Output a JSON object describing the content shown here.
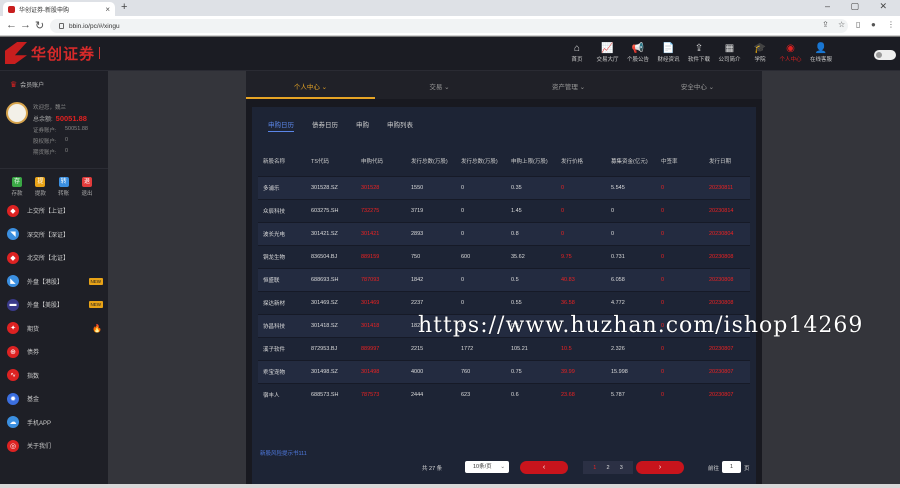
{
  "browser": {
    "tab_title": "华创证券-新股申购",
    "url": "bbin.io/pc/#/xingu",
    "close": "×",
    "new_tab": "+",
    "window_controls": "–  ▢  ✕"
  },
  "app": {
    "logo_text": "华创证券",
    "nav": [
      {
        "label": "首页",
        "icon": "home-icon",
        "glyph": "⌂"
      },
      {
        "label": "交易大厅",
        "icon": "chart-icon",
        "glyph": "📈"
      },
      {
        "label": "个股公告",
        "icon": "speaker-icon",
        "glyph": "📢"
      },
      {
        "label": "财经资讯",
        "icon": "news-icon",
        "glyph": "📄"
      },
      {
        "label": "软件下载",
        "icon": "download-icon",
        "glyph": "⇪"
      },
      {
        "label": "公司简介",
        "icon": "company-icon",
        "glyph": "▦"
      },
      {
        "label": "学院",
        "icon": "academy-icon",
        "glyph": "🎓"
      },
      {
        "label": "个人中心",
        "icon": "user-icon",
        "glyph": "◉",
        "active": true
      },
      {
        "label": "在线客服",
        "icon": "support-icon",
        "glyph": "👤"
      }
    ],
    "colors": {
      "brand": "#c81e1e",
      "accent": "#e6a425",
      "link": "#4f7ae0"
    }
  },
  "sidebar": {
    "header": "会员账户",
    "greeting": "欢迎您，魏兰",
    "total_label": "总余额:",
    "total_value": "50051.88",
    "rows": [
      {
        "label": "证券账户:",
        "value": "50051.88"
      },
      {
        "label": "股权账户:",
        "value": "0"
      },
      {
        "label": "期货账户:",
        "value": "0"
      }
    ],
    "quick": [
      {
        "label": "存款",
        "glyph": "存",
        "color": "#3aa845"
      },
      {
        "label": "提款",
        "glyph": "提",
        "color": "#e8a317"
      },
      {
        "label": "转账",
        "glyph": "转",
        "color": "#3b8fe0"
      },
      {
        "label": "退出",
        "glyph": "退",
        "color": "#e23b3b"
      }
    ],
    "menu": [
      {
        "label": "上交所【上证】",
        "glyph": "◆",
        "color": "#d22"
      },
      {
        "label": "深交所【深证】",
        "glyph": "◥",
        "color": "#3b8fe0"
      },
      {
        "label": "北交所【北证】",
        "glyph": "◆",
        "color": "#d22"
      },
      {
        "label": "外盘【港股】",
        "glyph": "◣",
        "color": "#3b8fe0",
        "badge": "NEW"
      },
      {
        "label": "外盘【美股】",
        "glyph": "▬",
        "color": "#3a3a8a",
        "badge": "NEW"
      },
      {
        "label": "期货",
        "glyph": "✦",
        "color": "#d22",
        "fire": "🔥"
      },
      {
        "label": "债券",
        "glyph": "⊕",
        "color": "#d22"
      },
      {
        "label": "指数",
        "glyph": "∿",
        "color": "#d22"
      },
      {
        "label": "基金",
        "glyph": "✹",
        "color": "#3b6fe0"
      },
      {
        "label": "手机APP",
        "glyph": "☁",
        "color": "#3b8fe0"
      },
      {
        "label": "关于我们",
        "glyph": "◎",
        "color": "#d22"
      }
    ]
  },
  "subnav": [
    {
      "label": "个人中心",
      "active": true
    },
    {
      "label": "交易",
      "active": false
    },
    {
      "label": "资产管理",
      "active": false
    },
    {
      "label": "安全中心",
      "active": false
    }
  ],
  "panel_tabs": [
    {
      "label": "申购日历",
      "active": true
    },
    {
      "label": "债券日历",
      "active": false
    },
    {
      "label": "申购",
      "active": false
    },
    {
      "label": "申购列表",
      "active": false
    }
  ],
  "table": {
    "columns": [
      "新股名称",
      "TS代码",
      "申购代码",
      "发行总数(万股)",
      "发行总数(万股)",
      "申购上限(万股)",
      "发行价格",
      "募集资金(亿元)",
      "中签率",
      "发行日期"
    ],
    "rows": [
      [
        "多浦乐",
        "301528.SZ",
        "301528",
        "1550",
        "0",
        "0.35",
        "0",
        "5.545",
        "0",
        "20230811"
      ],
      [
        "众辰科技",
        "603275.SH",
        "732275",
        "3719",
        "0",
        "1.45",
        "0",
        "0",
        "0",
        "20230814"
      ],
      [
        "波长光电",
        "301421.SZ",
        "301421",
        "2893",
        "0",
        "0.8",
        "0",
        "0",
        "0",
        "20230804"
      ],
      [
        "铜龙生物",
        "836504.BJ",
        "889159",
        "750",
        "600",
        "35.62",
        "9.75",
        "0.731",
        "0",
        "20230808"
      ],
      [
        "恒盛联",
        "688693.SH",
        "787093",
        "1842",
        "0",
        "0.5",
        "40.83",
        "6.058",
        "0",
        "20230808"
      ],
      [
        "探达新材",
        "301469.SZ",
        "301469",
        "2237",
        "0",
        "0.55",
        "36.58",
        "4.772",
        "0",
        "20230808"
      ],
      [
        "协昌科技",
        "301418.SZ",
        "301418",
        "1823",
        "0",
        "0.5",
        "",
        "",
        "0",
        ""
      ],
      [
        "溪子软件",
        "872953.BJ",
        "889997",
        "2215",
        "1772",
        "105.21",
        "10.5",
        "2.326",
        "0",
        "20230807"
      ],
      [
        "乖宝宠物",
        "301498.SZ",
        "301498",
        "4000",
        "760",
        "0.75",
        "39.99",
        "15.998",
        "0",
        "20230807"
      ],
      [
        "宿丰人",
        "688573.SH",
        "787573",
        "2444",
        "623",
        "0.6",
        "23.68",
        "5.787",
        "0",
        "20230807"
      ]
    ]
  },
  "risk_text": "新股风险提示书111",
  "pager": {
    "total": "共 27 条",
    "page_size": "10条/页",
    "prev": "‹",
    "next": "›",
    "pages": [
      "1",
      "2",
      "3"
    ],
    "goto_label": "前往",
    "goto_value": "1",
    "page_suffix": "页"
  },
  "watermark": "https://www.huzhan.com/ishop14269"
}
